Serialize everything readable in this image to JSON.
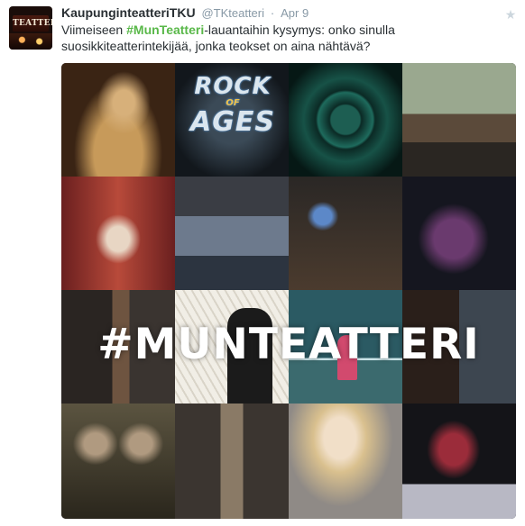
{
  "tweet": {
    "avatar_text": "TEATTERI",
    "fullname": "KaupunginteatteriTKU",
    "username": "@TKteatteri",
    "separator": "·",
    "time": "Apr 9",
    "text_before": "Viimeiseen ",
    "hashtag": "#MunTeatteri",
    "text_after": "-lauantaihin kysymys: onko sinulla suosikkiteatterintekijää, jonka teokset on aina nähtävä?"
  },
  "photo": {
    "overlay_text": "#MUNTEATTERI",
    "rock_logo": {
      "top": "ROCK",
      "middle": "OF",
      "bottom": "AGES"
    },
    "tiles": [
      {
        "name": "tile-singer",
        "color": "#6b4a2c"
      },
      {
        "name": "tile-rock-of-ages",
        "color": "#1a1f26"
      },
      {
        "name": "tile-actor-tunnel",
        "color": "#0e3b33"
      },
      {
        "name": "tile-couple-kitchen",
        "color": "#7b8a74"
      },
      {
        "name": "tile-cabaret",
        "color": "#8a2a2a"
      },
      {
        "name": "tile-sofa",
        "color": "#5b6675"
      },
      {
        "name": "tile-tv-room",
        "color": "#2a2725"
      },
      {
        "name": "tile-actor-purple",
        "color": "#1f2033"
      },
      {
        "name": "tile-suit-couple",
        "color": "#3a3430"
      },
      {
        "name": "tile-comic-drawing",
        "color": "#e6e2d8"
      },
      {
        "name": "tile-stage-set",
        "color": "#3f6a6c"
      },
      {
        "name": "tile-two-men",
        "color": "#2a2828"
      },
      {
        "name": "tile-fantasy-women",
        "color": "#4f4a38"
      },
      {
        "name": "tile-girl-doorway",
        "color": "#5e5448"
      },
      {
        "name": "tile-blonde-woman",
        "color": "#b8b0a8"
      },
      {
        "name": "tile-pianist",
        "color": "#1b1b1f"
      }
    ]
  }
}
